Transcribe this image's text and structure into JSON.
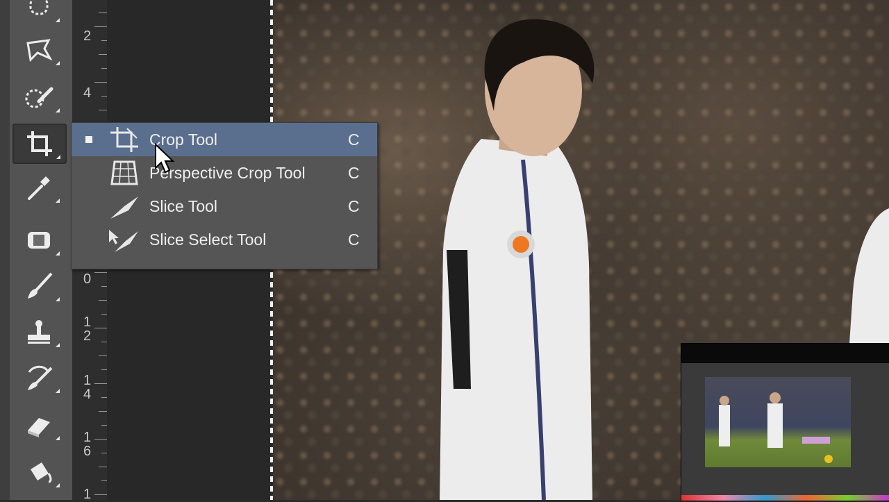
{
  "ruler": {
    "numbers": [
      "2",
      "4",
      "0",
      "1",
      "2",
      "1",
      "4",
      "1",
      "6",
      "1"
    ]
  },
  "flyout_menu": {
    "items": [
      {
        "label": "Crop Tool",
        "shortcut": "C",
        "selected": true,
        "icon": "crop-icon"
      },
      {
        "label": "Perspective Crop Tool",
        "shortcut": "C",
        "selected": false,
        "icon": "perspective-crop-icon"
      },
      {
        "label": "Slice Tool",
        "shortcut": "C",
        "selected": false,
        "icon": "slice-icon"
      },
      {
        "label": "Slice Select Tool",
        "shortcut": "C",
        "selected": false,
        "icon": "slice-select-icon"
      }
    ]
  },
  "toolbar": {
    "tools": [
      "marquee-icon",
      "polygon-lasso-icon",
      "quick-selection-icon",
      "crop-icon",
      "eyedropper-icon",
      "spot-healing-icon",
      "brush-icon",
      "clone-stamp-icon",
      "history-brush-icon",
      "eraser-icon",
      "paint-bucket-icon"
    ],
    "active_tool": "crop-icon"
  },
  "colors": {
    "menu_bg": "#555555",
    "menu_selected": "#5a6e8e",
    "toolbar_bg": "#535353"
  }
}
